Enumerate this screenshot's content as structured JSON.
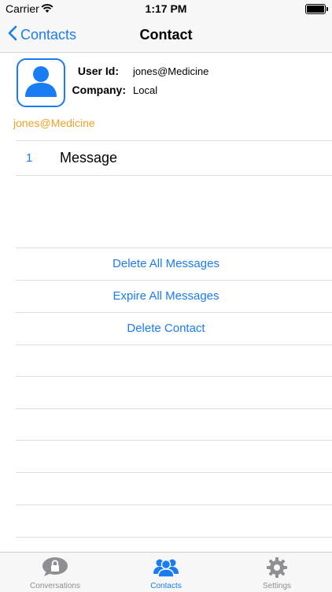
{
  "status_bar": {
    "carrier": "Carrier",
    "time": "1:17 PM"
  },
  "nav": {
    "back_label": "Contacts",
    "title": "Contact"
  },
  "contact": {
    "user_id_label": "User Id:",
    "user_id_value": "jones@Medicine",
    "company_label": "Company:",
    "company_value": "Local",
    "handle": "jones@Medicine"
  },
  "messages": {
    "count": "1",
    "label": "Message"
  },
  "actions": {
    "delete_all": "Delete All Messages",
    "expire_all": "Expire All Messages",
    "delete_contact": "Delete Contact"
  },
  "tabs": [
    {
      "label": "Conversations",
      "icon": "lock-speech-bubble-icon",
      "active": false
    },
    {
      "label": "Contacts",
      "icon": "people-icon",
      "active": true
    },
    {
      "label": "Settings",
      "icon": "gear-icon",
      "active": false
    }
  ],
  "colors": {
    "accent": "#1a7cf2",
    "handle": "#f0a12a",
    "inactive": "#8e8e93"
  }
}
